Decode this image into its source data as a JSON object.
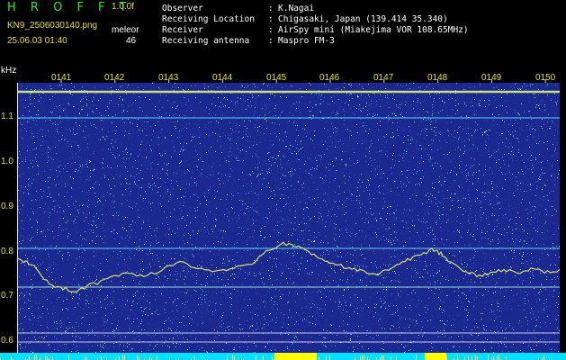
{
  "header": {
    "app_title": "H R O F F T",
    "version": "1.0.0f",
    "filename": "KN9_2506030140.png",
    "station": "meleor",
    "datetime": "25.06.03 01:40",
    "count": "46",
    "info": [
      {
        "label": "Observer",
        "value": "K.Nagai"
      },
      {
        "label": "Receiving Location",
        "value": "Chigasaki, Japan (139.414 35.340)"
      },
      {
        "label": "Receiver",
        "value": "AirSpy mini (Miakejima VOR 108.65MHz)"
      },
      {
        "label": "Receiving antenna",
        "value": "Maspro FM-3"
      }
    ],
    "separator": ":"
  },
  "axis": {
    "y_unit": "kHz",
    "y_ticks": [
      "1.1",
      "1.0",
      "0.9",
      "0.8",
      "0.7",
      "0.6"
    ],
    "x_ticks": [
      "0141",
      "0142",
      "0143",
      "0144",
      "0145",
      "0146",
      "0147",
      "0148",
      "0149",
      "0150"
    ]
  },
  "colors": {
    "background": "#1a2890",
    "trace": "#d8e060",
    "strip": "#00e0ff",
    "burst": "#ffff00",
    "label_yellow": "#e6e600",
    "title_green": "#2ee62e"
  }
}
